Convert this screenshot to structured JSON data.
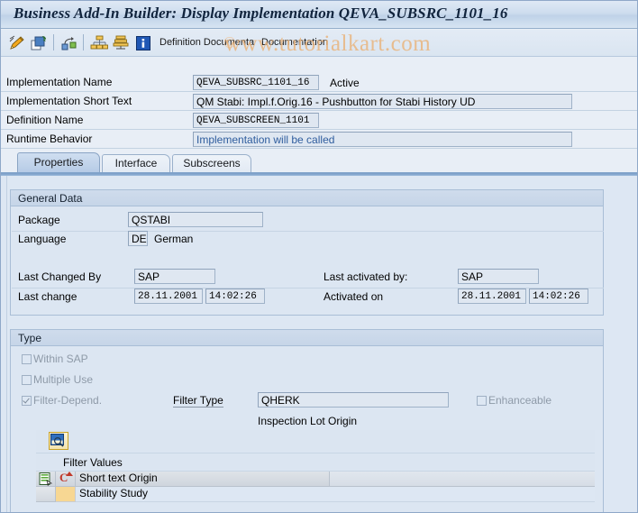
{
  "window": {
    "title": "Business Add-In Builder: Display Implementation QEVA_SUBSRC_1101_16"
  },
  "watermark": {
    "text": "www.tutorialkart.com",
    "copyright": "©"
  },
  "toolbar": {
    "icons": [
      {
        "name": "change-pencil-icon",
        "title": "Display <-> Change"
      },
      {
        "name": "create-copy-icon",
        "title": "Other Implementation"
      },
      {
        "name": "assign-node-icon",
        "title": "Display Definition"
      },
      {
        "name": "hierarchy-icon",
        "title": "Implementation Overview"
      },
      {
        "name": "stack-icon",
        "title": "Definition"
      },
      {
        "name": "info-icon",
        "title": "Information"
      }
    ],
    "button_definition_documentation": "Definition Documenta",
    "button_documentation": "Documentation"
  },
  "header": {
    "rows": [
      {
        "label": "Implementation Name",
        "value": "QEVA_SUBSRC_1101_16",
        "status": "Active"
      },
      {
        "label": "Implementation Short Text",
        "value": "QM Stabi: Impl.f.Orig.16 - Pushbutton for Stabi History UD",
        "status": ""
      },
      {
        "label": "Definition Name",
        "value": "QEVA_SUBSCREEN_1101",
        "status": ""
      },
      {
        "label": "Runtime Behavior",
        "value": "Implementation will be called",
        "status": ""
      }
    ]
  },
  "tabs": [
    {
      "label": "Properties",
      "active": true
    },
    {
      "label": "Interface",
      "active": false
    },
    {
      "label": "Subscreens",
      "active": false
    }
  ],
  "general_data": {
    "title": "General Data",
    "package_label": "Package",
    "package_value": "QSTABI",
    "language_label": "Language",
    "language_code": "DE",
    "language_text": "German",
    "last_changed_by_label": "Last Changed By",
    "last_changed_by_value": "SAP",
    "last_change_label": "Last change",
    "last_change_date": "28.11.2001",
    "last_change_time": "14:02:26",
    "last_activated_by_label": "Last activated by:",
    "last_activated_by_value": "SAP",
    "activated_on_label": "Activated on",
    "activated_on_date": "28.11.2001",
    "activated_on_time": "14:02:26"
  },
  "type_section": {
    "title": "Type",
    "checkboxes": [
      {
        "label": "Within SAP",
        "checked": false
      },
      {
        "label": "Multiple Use",
        "checked": false
      },
      {
        "label": "Filter-Depend.",
        "checked": true
      }
    ],
    "enhanceable": {
      "label": "Enhanceable",
      "checked": false
    },
    "filter_type_label": "Filter Type",
    "filter_type_value": "QHERK",
    "filter_type_description": "Inspection Lot Origin"
  },
  "filter_table": {
    "search_button_name": "display-filter-values-button",
    "caption": "Filter Values",
    "columns": [
      {
        "key": "code",
        "label": "C",
        "sorted": true
      },
      {
        "key": "short_text",
        "label": "Short text Origin",
        "sorted": false
      }
    ],
    "rows": [
      {
        "code": "",
        "short_text": "Stability Study"
      }
    ]
  },
  "colors": {
    "title_gradient_start": "#dfe9f5",
    "title_gradient_end": "#bfd2e8",
    "page_background": "#dde7f3",
    "field_background": "#dfe7f1",
    "field_border": "#9fb2c8",
    "runtime_text": "#2f5d9e",
    "watermark": "#e9b57e",
    "row_highlight": "#f7d793",
    "tab_active": "#b6cbe6"
  }
}
